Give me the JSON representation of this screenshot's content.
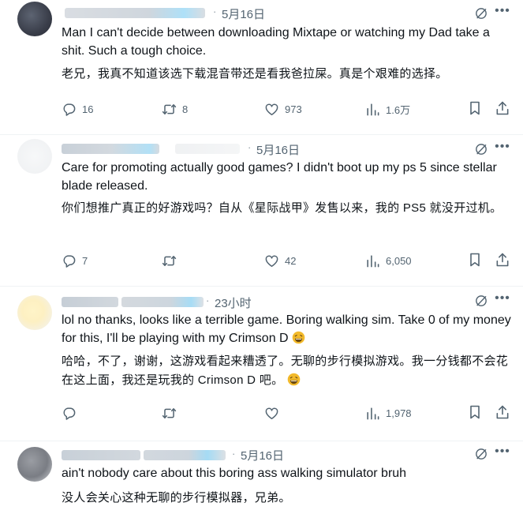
{
  "colors": {
    "text": "#0f1419",
    "muted": "#536471",
    "emoji": "#f2b92b",
    "blur": "#c8d4df",
    "blur_accent": "#9fd6f5"
  },
  "replies": [
    {
      "date": "5月16日",
      "text": "Man I can't decide between downloading Mixtape or watching my Dad take a shit. Such a tough choice.",
      "translation": "老兄，我真不知道该选下载混音带还是看我爸拉屎。真是个艰难的选择。",
      "replies": "16",
      "reposts": "8",
      "likes": "973",
      "views": "1.6万"
    },
    {
      "date": "5月16日",
      "text": "Care for promoting actually good games? I didn't boot up my ps 5 since stellar blade released.",
      "translation": "你们想推广真正的好游戏吗？自从《星际战甲》发售以来，我的 PS5 就没开过机。",
      "replies": "7",
      "reposts": "",
      "likes": "42",
      "views": "6,050"
    },
    {
      "date": "23小时",
      "text": "lol no thanks, looks like a terrible game. Boring walking sim. Take 0 of my money for this, I'll be playing with my Crimson D",
      "translation": "哈哈，不了，谢谢，这游戏看起来糟透了。无聊的步行模拟游戏。我一分钱都不会花在这上面，我还是玩我的 Crimson D 吧。",
      "replies": "",
      "reposts": "",
      "likes": "",
      "views": "1,978"
    },
    {
      "date": "5月16日",
      "text": "ain't nobody care about this boring ass walking simulator bruh",
      "translation": "没人会关心这种无聊的步行模拟器，兄弟。"
    }
  ]
}
